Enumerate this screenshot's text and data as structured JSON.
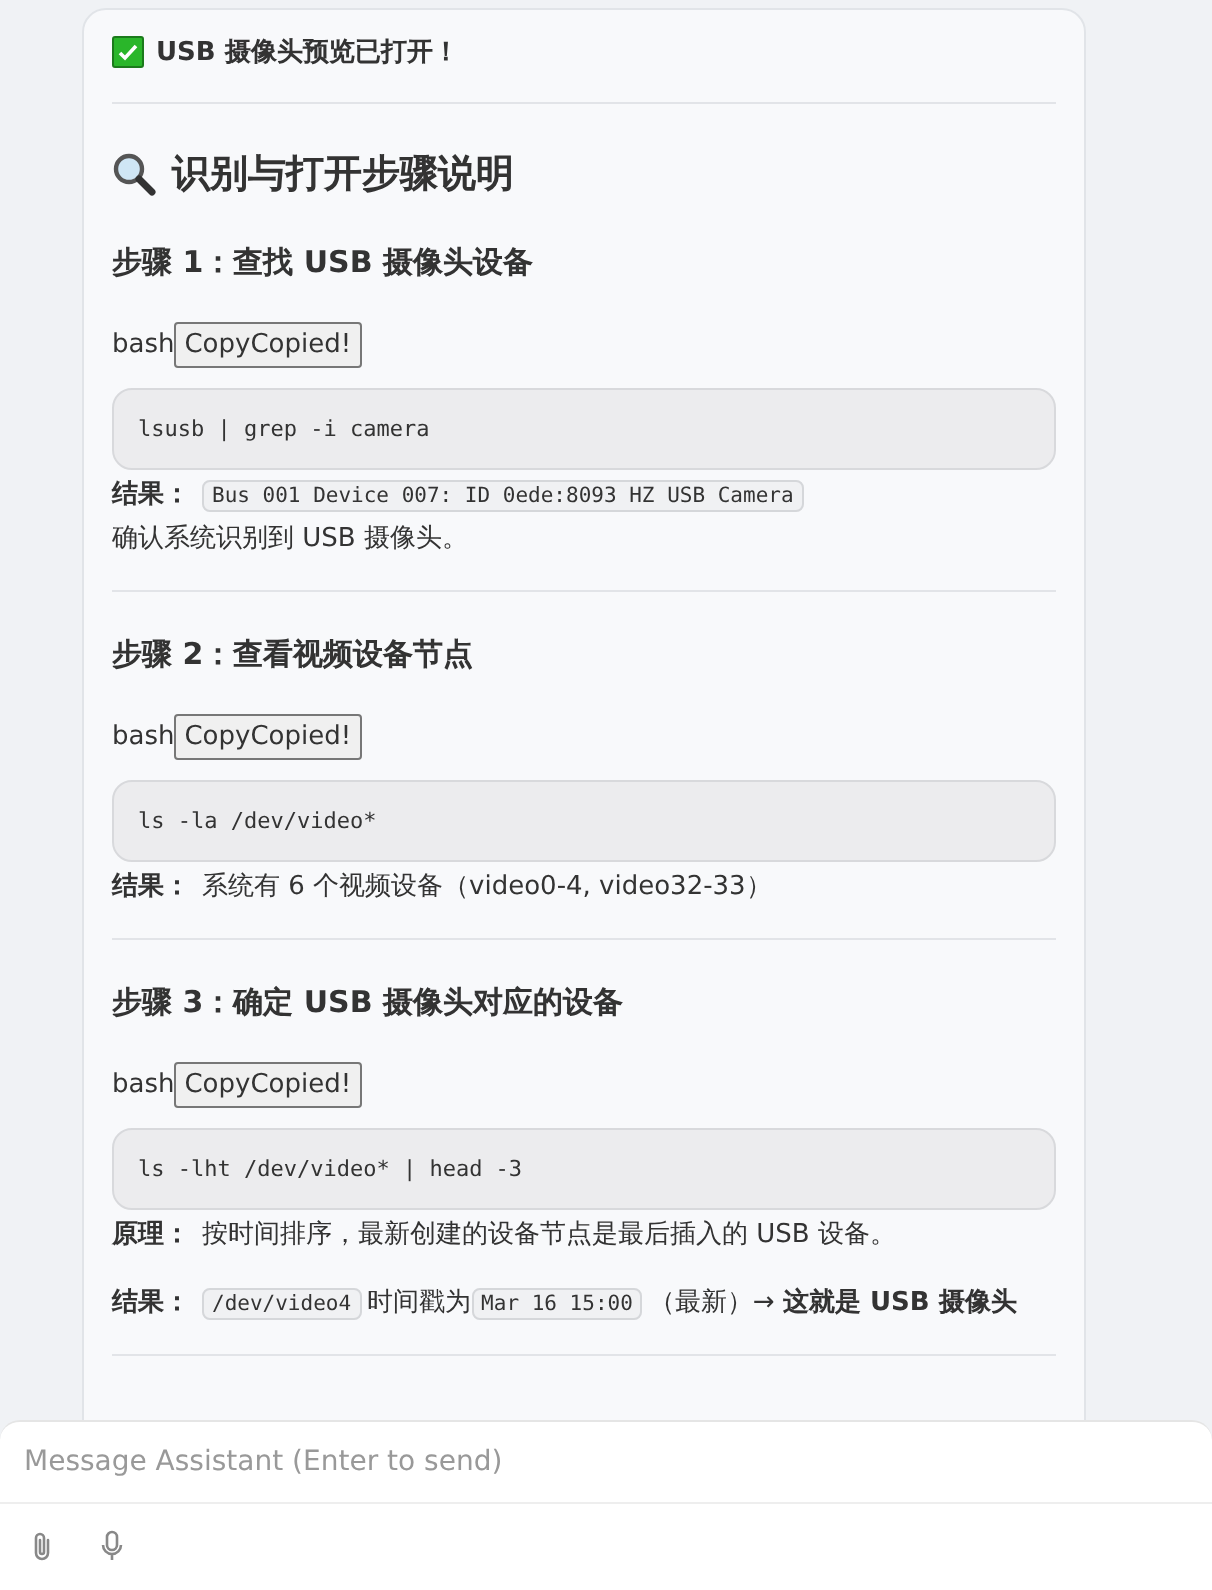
{
  "status": {
    "text": "USB 摄像头预览已打开！"
  },
  "heading": "识别与打开步骤说明",
  "steps": [
    {
      "title": "步骤 1：查找 USB 摄像头设备",
      "lang": "bash",
      "copy": "CopyCopied!",
      "code": "lsusb | grep -i camera",
      "notes": [
        {
          "label": "结果：",
          "parts": [
            {
              "kind": "code",
              "text": "Bus 001 Device 007: ID 0ede:8093 HZ USB Camera"
            },
            {
              "kind": "break"
            },
            {
              "kind": "text",
              "text": "确认系统识别到 USB 摄像头。"
            }
          ]
        }
      ]
    },
    {
      "title": "步骤 2：查看视频设备节点",
      "lang": "bash",
      "copy": "CopyCopied!",
      "code": "ls -la /dev/video*",
      "notes": [
        {
          "label": "结果：",
          "parts": [
            {
              "kind": "text",
              "text": "系统有 6 个视频设备（video0-4, video32-33）"
            }
          ]
        }
      ]
    },
    {
      "title": "步骤 3：确定 USB 摄像头对应的设备",
      "lang": "bash",
      "copy": "CopyCopied!",
      "code": "ls -lht /dev/video* | head -3",
      "notes": [
        {
          "label": "原理：",
          "parts": [
            {
              "kind": "text",
              "text": "按时间排序，最新创建的设备节点是最后插入的 USB 设备。"
            }
          ]
        },
        {
          "label": "结果：",
          "parts": [
            {
              "kind": "code",
              "text": "/dev/video4"
            },
            {
              "kind": "text",
              "text": "时间戳为"
            },
            {
              "kind": "code",
              "text": "Mar 16 15:00"
            },
            {
              "kind": "text",
              "text": "（最新）→ **这就是 USB 摄像头**"
            }
          ]
        }
      ]
    }
  ],
  "composer": {
    "placeholder": "Message Assistant (Enter to send)"
  }
}
